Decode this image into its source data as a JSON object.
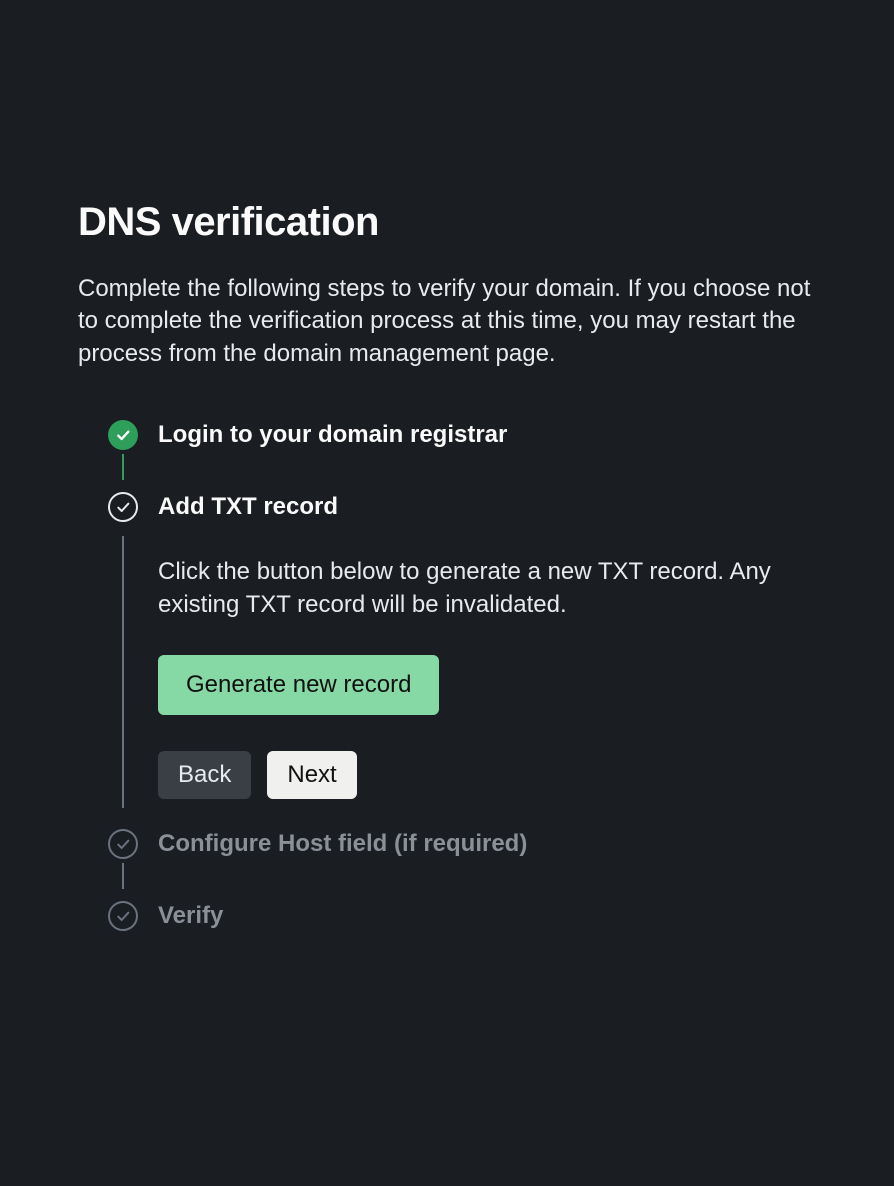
{
  "page": {
    "title": "DNS verification",
    "description": "Complete the following steps to verify your domain. If you choose not to complete the verification process at this time, you may restart the process from the domain management page."
  },
  "steps": {
    "step1": {
      "title": "Login to your domain registrar"
    },
    "step2": {
      "title": "Add TXT record",
      "description": "Click the button below to generate a new TXT record. Any existing TXT record will be invalidated.",
      "generate_label": "Generate new record",
      "back_label": "Back",
      "next_label": "Next"
    },
    "step3": {
      "title": "Configure Host field (if required)"
    },
    "step4": {
      "title": "Verify"
    }
  }
}
